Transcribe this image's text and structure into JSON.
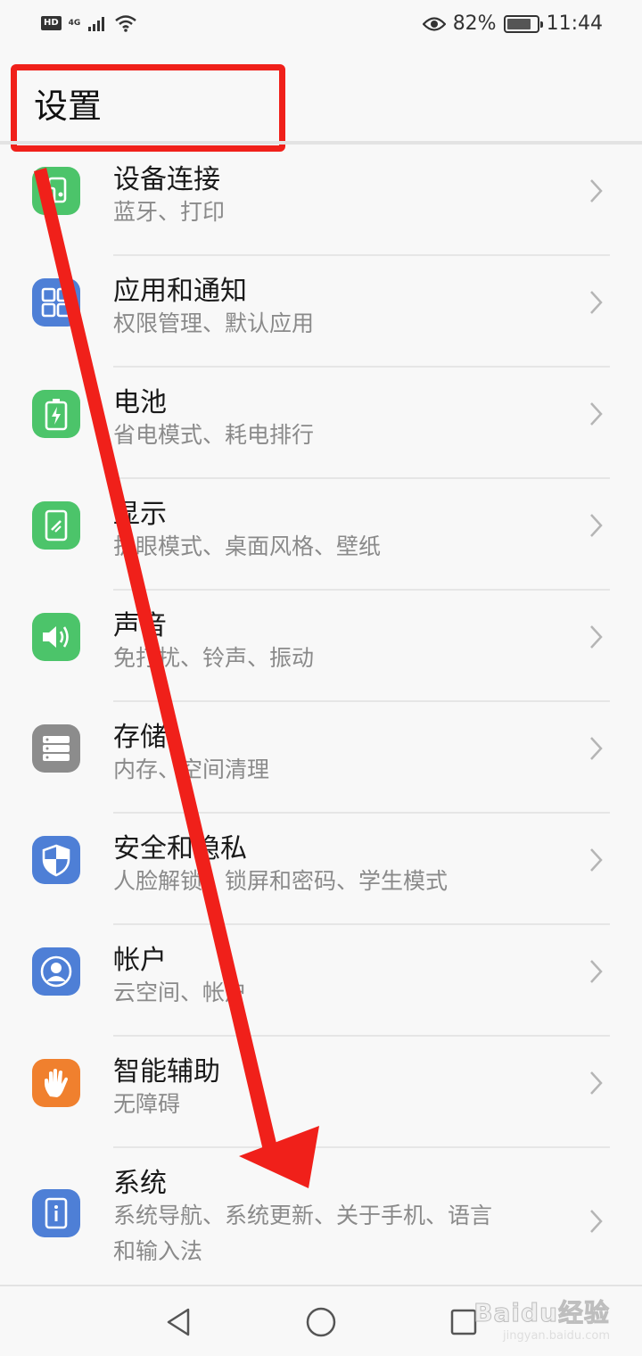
{
  "status_bar": {
    "hd": "HD",
    "network": "4G",
    "battery_percent": "82%",
    "battery_level": 0.82,
    "time": "11:44",
    "icons": [
      "signal-icon",
      "wifi-icon",
      "eye-icon",
      "battery-icon"
    ]
  },
  "header": {
    "title": "设置"
  },
  "settings": [
    {
      "title": "设备连接",
      "subtitle": "蓝牙、打印",
      "icon": "device-connect-icon",
      "color": "#4cc46a"
    },
    {
      "title": "应用和通知",
      "subtitle": "权限管理、默认应用",
      "icon": "apps-icon",
      "color": "#4e7fd6"
    },
    {
      "title": "电池",
      "subtitle": "省电模式、耗电排行",
      "icon": "battery-icon",
      "color": "#4cc46a"
    },
    {
      "title": "显示",
      "subtitle": "护眼模式、桌面风格、壁纸",
      "icon": "display-icon",
      "color": "#4cc46a"
    },
    {
      "title": "声音",
      "subtitle": "免打扰、铃声、振动",
      "icon": "sound-icon",
      "color": "#4cc46a"
    },
    {
      "title": "存储",
      "subtitle": "内存、空间清理",
      "icon": "storage-icon",
      "color": "#8c8c8c"
    },
    {
      "title": "安全和隐私",
      "subtitle": "人脸解锁、锁屏和密码、学生模式",
      "icon": "shield-icon",
      "color": "#4e7fd6"
    },
    {
      "title": "帐户",
      "subtitle": "云空间、帐户",
      "icon": "account-icon",
      "color": "#4e7fd6"
    },
    {
      "title": "智能辅助",
      "subtitle": "无障碍",
      "icon": "hand-icon",
      "color": "#f0802e"
    },
    {
      "title": "系统",
      "subtitle": "系统导航、系统更新、关于手机、语言",
      "subtitle2": "和输入法",
      "icon": "system-icon",
      "color": "#4e7fd6"
    }
  ],
  "watermark": {
    "main": "Baidu经验",
    "sub": "jingyan.baidu.com"
  },
  "colors": {
    "annotation": "#f0201a",
    "background": "#f8f8f8"
  }
}
